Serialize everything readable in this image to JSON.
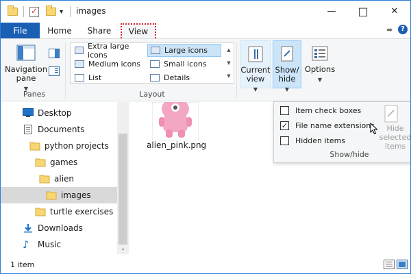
{
  "window": {
    "title": "images",
    "controls": {
      "minimize": "—",
      "maximize": "□",
      "close": "✕"
    }
  },
  "quick_access": {
    "dropdown_glyph": "▾"
  },
  "tabs": [
    {
      "label": "File"
    },
    {
      "label": "Home"
    },
    {
      "label": "Share"
    },
    {
      "label": "View"
    }
  ],
  "ribbon": {
    "panes": {
      "navigation_pane_label": "Navigation\npane",
      "group_label": "Panes"
    },
    "layout": {
      "group_label": "Layout",
      "items": [
        {
          "label": "Extra large icons"
        },
        {
          "label": "Large icons"
        },
        {
          "label": "Medium icons"
        },
        {
          "label": "Small icons"
        },
        {
          "label": "List"
        },
        {
          "label": "Details"
        }
      ],
      "selected": "Large icons"
    },
    "current_view_label": "Current\nview",
    "show_hide_label": "Show/\nhide",
    "options_label": "Options"
  },
  "show_hide_dropdown": {
    "items": [
      {
        "label": "Item check boxes",
        "checked": false
      },
      {
        "label": "File name extensions",
        "checked": true
      },
      {
        "label": "Hidden items",
        "checked": false
      }
    ],
    "hide_selected_label": "Hide selected\nitems",
    "group_label": "Show/hide"
  },
  "nav_pane": {
    "items": [
      {
        "label": "Desktop",
        "icon": "desktop-icon",
        "indent": 0
      },
      {
        "label": "Documents",
        "icon": "documents-icon",
        "indent": 0
      },
      {
        "label": "python projects",
        "icon": "folder-icon",
        "indent": 1
      },
      {
        "label": "games",
        "icon": "folder-icon",
        "indent": 2
      },
      {
        "label": "alien",
        "icon": "folder-icon",
        "indent": 3
      },
      {
        "label": "images",
        "icon": "folder-icon",
        "indent": 4,
        "selected": true
      },
      {
        "label": "turtle exercises",
        "icon": "folder-icon",
        "indent": 2
      },
      {
        "label": "Downloads",
        "icon": "downloads-icon",
        "indent": 0
      },
      {
        "label": "Music",
        "icon": "music-icon",
        "indent": 0
      }
    ]
  },
  "content": {
    "files": [
      {
        "name": "alien_pink.png"
      }
    ]
  },
  "status_bar": {
    "item_count": "1 item"
  },
  "colors": {
    "accent": "#1a5fb4",
    "selection": "#cce4f7",
    "view_tab_outline": "#d8262a"
  }
}
